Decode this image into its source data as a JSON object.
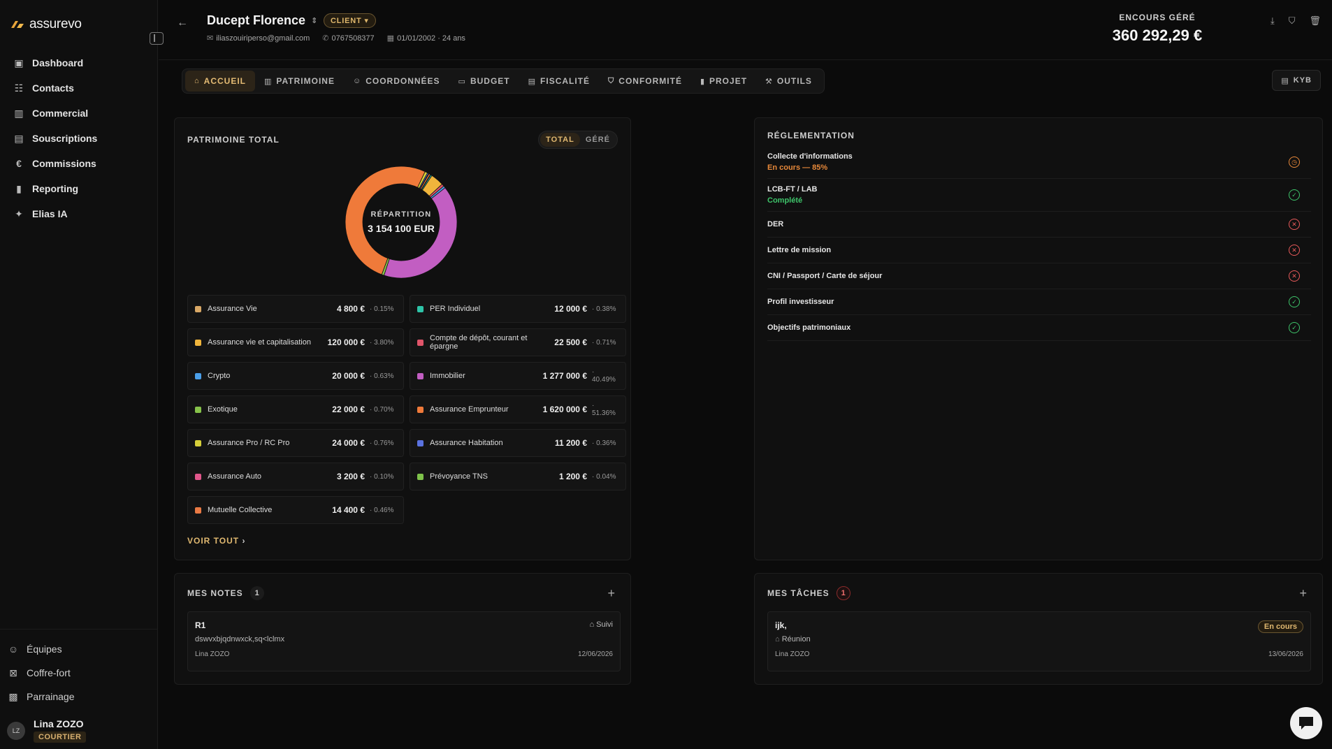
{
  "app": {
    "logo_text": "assurevo"
  },
  "sidebar": {
    "items": [
      {
        "label": "Dashboard",
        "icon": "dashboard-icon"
      },
      {
        "label": "Contacts",
        "icon": "contacts-icon"
      },
      {
        "label": "Commercial",
        "icon": "building-icon"
      },
      {
        "label": "Souscriptions",
        "icon": "document-icon"
      },
      {
        "label": "Commissions",
        "icon": "euro-icon"
      },
      {
        "label": "Reporting",
        "icon": "bar-chart-icon"
      },
      {
        "label": "Elias IA",
        "icon": "sparkle-icon"
      }
    ],
    "bottom_items": [
      {
        "label": "Équipes",
        "icon": "users-icon"
      },
      {
        "label": "Coffre-fort",
        "icon": "vault-icon"
      },
      {
        "label": "Parrainage",
        "icon": "gift-icon"
      }
    ],
    "user": {
      "initials": "LZ",
      "name": "Lina ZOZO",
      "role": "COURTIER"
    }
  },
  "header": {
    "client_name": "Ducept Florence",
    "client_type": "CLIENT",
    "email": "iliaszouiriperso@gmail.com",
    "phone": "0767508377",
    "birth": "01/01/2002 · 24 ans",
    "encours_label": "ENCOURS GÉRÉ",
    "encours_value": "360 292,29 €"
  },
  "tabs": [
    {
      "label": "ACCUEIL",
      "active": true,
      "icon": "home-icon"
    },
    {
      "label": "PATRIMOINE",
      "active": false,
      "icon": "bank-icon"
    },
    {
      "label": "COORDONNÉES",
      "active": false,
      "icon": "user-icon"
    },
    {
      "label": "BUDGET",
      "active": false,
      "icon": "wallet-icon"
    },
    {
      "label": "FISCALITÉ",
      "active": false,
      "icon": "receipt-icon"
    },
    {
      "label": "CONFORMITÉ",
      "active": false,
      "icon": "shield-icon"
    },
    {
      "label": "PROJET",
      "active": false,
      "icon": "bar-chart-icon"
    },
    {
      "label": "OUTILS",
      "active": false,
      "icon": "wrench-icon"
    }
  ],
  "kyb_label": "KYB",
  "patrimoine": {
    "title": "PATRIMOINE TOTAL",
    "toggle": [
      "TOTAL",
      "GÉRÉ"
    ],
    "center_label": "RÉPARTITION",
    "center_value": "3 154 100 EUR",
    "voir_tout": "VOIR TOUT",
    "items": [
      {
        "name": "Assurance Vie",
        "value": "4 800 €",
        "pct": "· 0.15%",
        "color": "#d9a866"
      },
      {
        "name": "PER Individuel",
        "value": "12 000 €",
        "pct": "· 0.38%",
        "color": "#2ec4a8"
      },
      {
        "name": "Assurance vie et capitalisation",
        "value": "120 000 €",
        "pct": "· 3.80%",
        "color": "#f0b53c"
      },
      {
        "name": "Compte de dépôt, courant et épargne",
        "value": "22 500 €",
        "pct": "· 0.71%",
        "color": "#e0556a"
      },
      {
        "name": "Crypto",
        "value": "20 000 €",
        "pct": "· 0.63%",
        "color": "#4a9ee8"
      },
      {
        "name": "Immobilier",
        "value": "1 277 000 €",
        "pct": "· 40.49%",
        "color": "#c25ec2"
      },
      {
        "name": "Exotique",
        "value": "22 000 €",
        "pct": "· 0.70%",
        "color": "#86c24a"
      },
      {
        "name": "Assurance Emprunteur",
        "value": "1 620 000 €",
        "pct": "· 51.36%",
        "color": "#ef7a3a"
      },
      {
        "name": "Assurance Pro / RC Pro",
        "value": "24 000 €",
        "pct": "· 0.76%",
        "color": "#d6cf3a"
      },
      {
        "name": "Assurance Habitation",
        "value": "11 200 €",
        "pct": "· 0.36%",
        "color": "#5a72e0"
      },
      {
        "name": "Assurance Auto",
        "value": "3 200 €",
        "pct": "· 0.10%",
        "color": "#e0568a"
      },
      {
        "name": "Prévoyance TNS",
        "value": "1 200 €",
        "pct": "· 0.04%",
        "color": "#7ec24a"
      },
      {
        "name": "Mutuelle Collective",
        "value": "14 400 €",
        "pct": "· 0.46%",
        "color": "#ea7a44"
      }
    ]
  },
  "reglementation": {
    "title": "RÉGLEMENTATION",
    "items": [
      {
        "title": "Collecte d'informations",
        "status": "En cours — 85%",
        "state": "pending",
        "color": "#e8893a"
      },
      {
        "title": "LCB-FT / LAB",
        "status": "Complété",
        "state": "ok",
        "color": "#3ec46a"
      },
      {
        "title": "DER",
        "status": "",
        "state": "ko",
        "color": "#e85a5a"
      },
      {
        "title": "Lettre de mission",
        "status": "",
        "state": "ko",
        "color": "#e85a5a"
      },
      {
        "title": "CNI / Passport / Carte de séjour",
        "status": "",
        "state": "ko",
        "color": "#e85a5a"
      },
      {
        "title": "Profil investisseur",
        "status": "",
        "state": "ok",
        "color": "#3ec46a"
      },
      {
        "title": "Objectifs patrimoniaux",
        "status": "",
        "state": "ok",
        "color": "#3ec46a"
      }
    ]
  },
  "notes": {
    "title": "MES NOTES",
    "count": "1",
    "card": {
      "title": "R1",
      "tag": "Suivi",
      "body": "dswvxbjqdnwxck,sq<lclmx",
      "author": "Lina ZOZO",
      "date": "12/06/2026"
    }
  },
  "taches": {
    "title": "MES TÂCHES",
    "count": "1",
    "card": {
      "title": "ijk,",
      "status": "En cours",
      "tag": "Réunion",
      "author": "Lina ZOZO",
      "date": "13/06/2026"
    }
  }
}
